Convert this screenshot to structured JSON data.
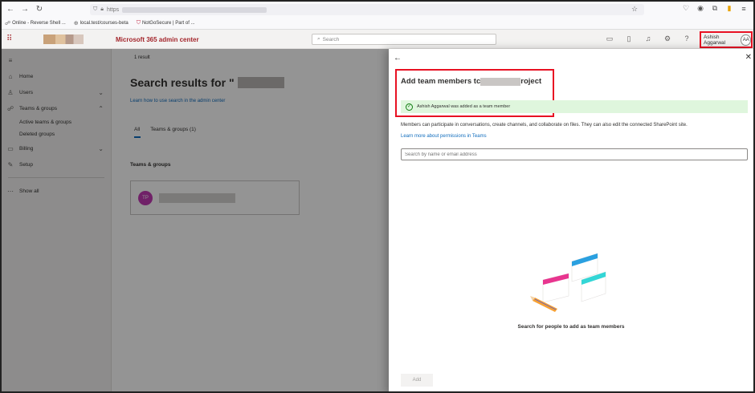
{
  "browser": {
    "url_prefix": "https",
    "bookmarks": [
      "Online - Reverse Shell ...",
      "local.test/courses-beta",
      "NotGoSecure | Part of ..."
    ]
  },
  "header": {
    "app_title": "Microsoft 365 admin center",
    "search_placeholder": "Search",
    "user_name": "Ashish Aggarwal",
    "user_initials": "AA",
    "accent_color": "#a4262c"
  },
  "nav": {
    "items": [
      {
        "label": "Home",
        "icon": "home-icon"
      },
      {
        "label": "Users",
        "icon": "person-icon"
      },
      {
        "label": "Teams & groups",
        "icon": "group-icon"
      },
      {
        "label": "Billing",
        "icon": "card-icon"
      },
      {
        "label": "Setup",
        "icon": "wrench-icon"
      },
      {
        "label": "Show all",
        "icon": "ellipsis-icon"
      }
    ],
    "sub_items": [
      "Active teams & groups",
      "Deleted groups"
    ]
  },
  "main": {
    "result_count": "1 result",
    "results_title": "Search results for \"",
    "learn_link": "Learn how to use search in the admin center",
    "tabs": [
      "All",
      "Teams & groups (1)"
    ],
    "section_label": "Teams & groups",
    "card_initials": "TP"
  },
  "panel": {
    "title_start": "Add team members tc",
    "title_end": "roject",
    "success_message": "Ashish Aggarwal was added as a team member",
    "description": "Members can participate in conversations, create channels, and collaborate on files. They can also edit the connected SharePoint site.",
    "permissions_link": "Learn more about permissions in Teams",
    "search_placeholder": "Search by name or email address",
    "empty_state": "Search for people to add as team members",
    "add_button": "Add",
    "success_color": "#dff6dd"
  }
}
